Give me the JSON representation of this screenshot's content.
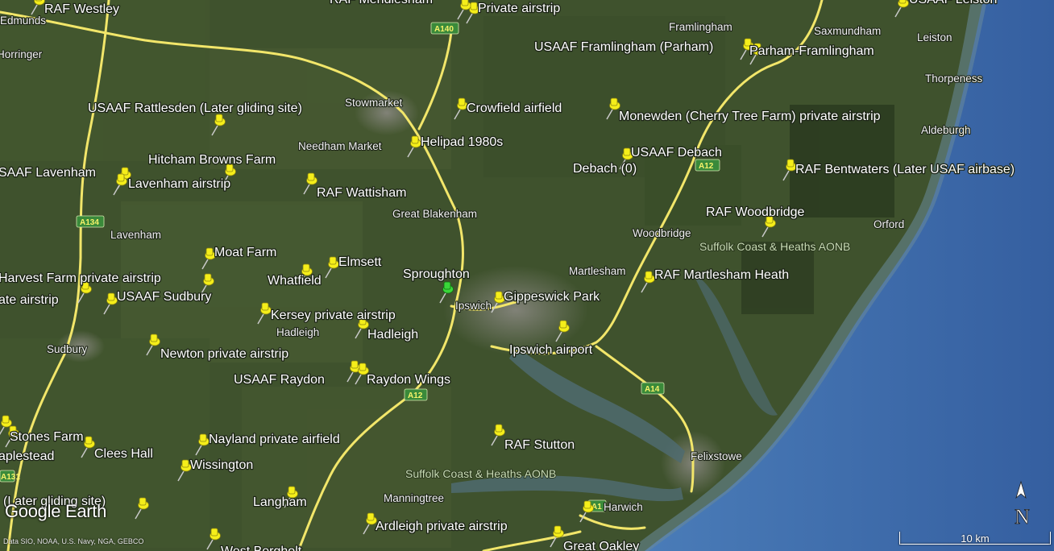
{
  "brand": {
    "logo": "Google Earth",
    "attribution": "Data SIO, NOAA, U.S. Navy, NGA, GEBCO"
  },
  "scale": {
    "label": "10 km"
  },
  "compass": {
    "label": "N",
    "icon": "north-arrow-icon"
  },
  "colors": {
    "land": "#3d4f2c",
    "sea": "#3a6ab0",
    "road": "#f2e66a",
    "pushpin": "#f5ee1a",
    "pushpin_selected": "#39d639"
  },
  "placemarks": [
    "RAF Westley",
    "Private airstrip",
    "USAAF Framlingham (Parham)",
    "Parham-Framlingham",
    "USAAF Rattlesden (Later gliding site)",
    "Crowfield airfield",
    "Monewden (Cherry Tree Farm) private airstrip",
    "Helipad 1980s",
    "Hitcham Browns Farm",
    "USAAF Debach",
    "Debach (0)",
    "RAF Bentwaters (Later USAF airbase)",
    "SAAF Lavenham",
    "Lavenham airstrip",
    "RAF Wattisham",
    "RAF Woodbridge",
    "Moat Farm",
    "Elmsett",
    "Harvest Farm private airstrip",
    "Sproughton",
    "Gippeswick Park",
    "RAF Martlesham Heath",
    "Whatfield",
    "ate airstrip",
    "USAAF Sudbury",
    "Kersey private airstrip",
    "Hadleigh",
    "Ipswich airport",
    "Newton private airstrip",
    "USAAF Raydon",
    "Raydon Wings",
    "Stones Farm",
    "Clees Hall",
    "Nayland private airfield",
    "RAF Stutton",
    "aplestead",
    "Wissington",
    "(Later gliding site)",
    "Langham",
    "Ardleigh private airstrip",
    "Great Oakley",
    "West Bergholt",
    "RAF Mendlesham",
    "USAAF Leiston"
  ],
  "places": [
    "Edmunds",
    "Horringer",
    "Stowmarket",
    "Needham Market",
    "Framlingham",
    "Saxmundham",
    "Leiston",
    "Thorpeness",
    "Aldeburgh",
    "Great Blakenham",
    "Woodbridge",
    "Orford",
    "Lavenham",
    "Martlesham",
    "Ipswich",
    "Hadleigh",
    "Sudbury",
    "Felixstowe",
    "Manningtree",
    "Harwich"
  ],
  "areas": [
    "Suffolk Coast & Heaths AONB",
    "Suffolk Coast & Heaths AONB"
  ],
  "roads": [
    "A140",
    "A12",
    "A134",
    "A14",
    "A12",
    "A1",
    "A131"
  ]
}
